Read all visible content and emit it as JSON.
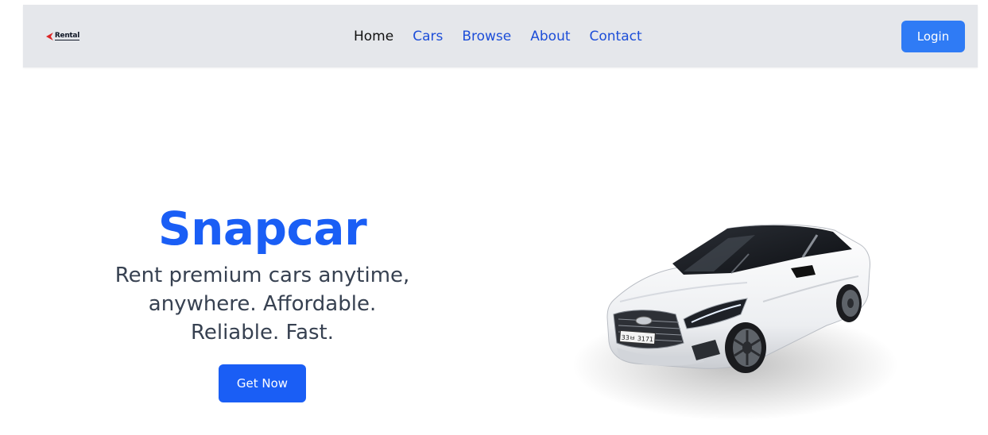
{
  "header": {
    "logo_text": "Rental",
    "nav": [
      {
        "label": "Home",
        "active": true
      },
      {
        "label": "Cars",
        "active": false
      },
      {
        "label": "Browse",
        "active": false
      },
      {
        "label": "About",
        "active": false
      },
      {
        "label": "Contact",
        "active": false
      }
    ],
    "login_label": "Login"
  },
  "hero": {
    "title": "Snapcar",
    "subtitle": "Rent premium cars anytime, anywhere. Affordable. Reliable. Fast.",
    "cta_label": "Get Now",
    "image": {
      "icon": "car-image",
      "plate_text": "33ㅂ 3171"
    }
  },
  "colors": {
    "accent": "#1a5ef5",
    "login_button": "#2f7bf5",
    "nav_link": "#1d4ed8",
    "nav_active": "#111111",
    "navbar_bg": "#e5e7eb",
    "subtitle_text": "#374151"
  }
}
